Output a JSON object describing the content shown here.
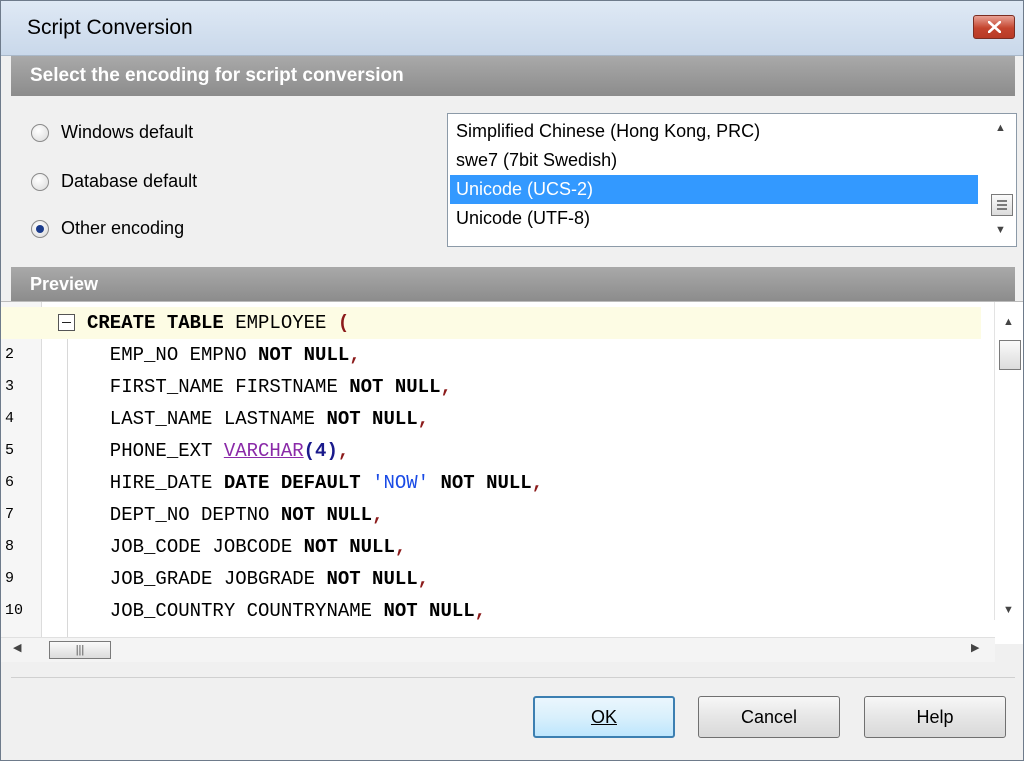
{
  "window": {
    "title": "Script Conversion"
  },
  "encoding_section": {
    "header": "Select the encoding for script conversion"
  },
  "radios": [
    {
      "label": "Windows default",
      "checked": false
    },
    {
      "label": "Database default",
      "checked": false
    },
    {
      "label": "Other encoding",
      "checked": true
    }
  ],
  "encodings": [
    {
      "label": "Simplified Chinese (Hong Kong, PRC)",
      "selected": false
    },
    {
      "label": "swe7 (7bit Swedish)",
      "selected": false
    },
    {
      "label": "Unicode (UCS-2)",
      "selected": true
    },
    {
      "label": "Unicode (UTF-8)",
      "selected": false
    }
  ],
  "preview": {
    "header": "Preview",
    "line_numbers": [
      "",
      "2",
      "3",
      "4",
      "5",
      "6",
      "7",
      "8",
      "9",
      "10"
    ],
    "lines": [
      "CREATE TABLE EMPLOYEE (",
      "  EMP_NO EMPNO NOT NULL,",
      "  FIRST_NAME FIRSTNAME NOT NULL,",
      "  LAST_NAME LASTNAME NOT NULL,",
      "  PHONE_EXT VARCHAR(4),",
      "  HIRE_DATE DATE DEFAULT 'NOW' NOT NULL,",
      "  DEPT_NO DEPTNO NOT NULL,",
      "  JOB_CODE JOBCODE NOT NULL,",
      "  JOB_GRADE JOBGRADE NOT NULL,",
      "  JOB_COUNTRY COUNTRYNAME NOT NULL,"
    ]
  },
  "buttons": {
    "ok": "OK",
    "cancel": "Cancel",
    "help": "Help"
  },
  "colors": {
    "selection": "#3399ff",
    "section_header": "#999999",
    "current_line": "#fdfce4"
  }
}
